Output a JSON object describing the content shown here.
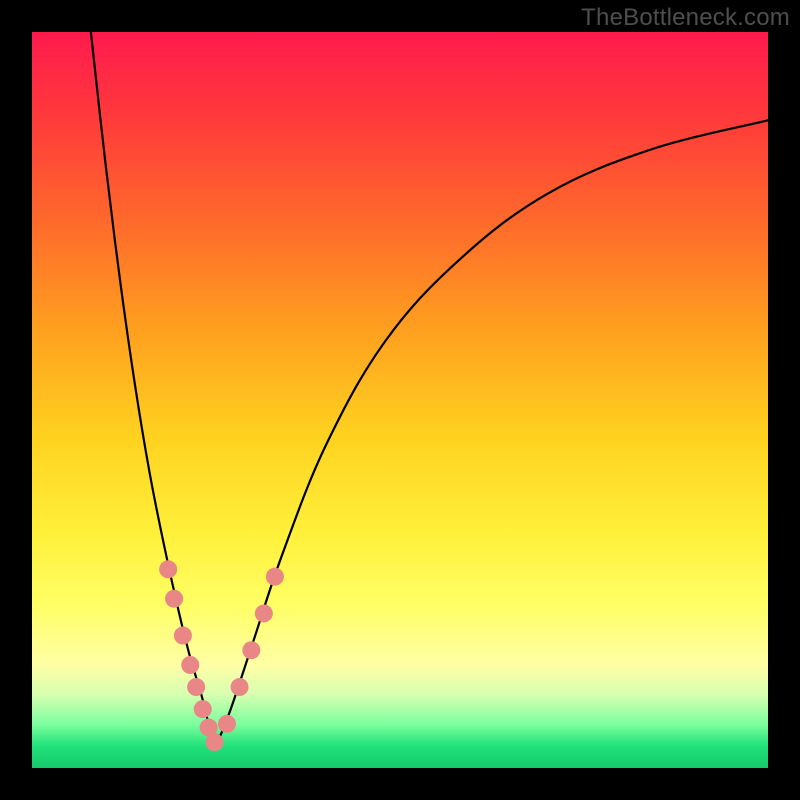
{
  "watermark": "TheBottleneck.com",
  "chart_data": {
    "type": "line",
    "title": "",
    "xlabel": "",
    "ylabel": "",
    "xlim": [
      0,
      100
    ],
    "ylim": [
      0,
      100
    ],
    "grid": false,
    "legend": false,
    "description": "Two valley-shaped curves forming a V; left branch descends steeply from top-left, right branch rises from the valley toward the upper-right. Background is a vertical red→yellow→green heat gradient. Salmon dots cluster near the valley bottom on both branches.",
    "series": [
      {
        "name": "left-branch",
        "x": [
          8,
          10,
          12,
          14,
          16,
          18,
          20,
          21.5,
          23,
          24,
          25
        ],
        "y": [
          100,
          82,
          66,
          52,
          40,
          30,
          21,
          15,
          10,
          6,
          3
        ]
      },
      {
        "name": "right-branch",
        "x": [
          25,
          27,
          30,
          34,
          40,
          48,
          58,
          70,
          84,
          100
        ],
        "y": [
          3,
          8,
          17,
          29,
          44,
          58,
          69,
          78,
          84,
          88
        ]
      }
    ],
    "dots": [
      {
        "branch": "left",
        "x": 18.5,
        "y": 27
      },
      {
        "branch": "left",
        "x": 19.3,
        "y": 23
      },
      {
        "branch": "left",
        "x": 20.5,
        "y": 18
      },
      {
        "branch": "left",
        "x": 21.5,
        "y": 14
      },
      {
        "branch": "left",
        "x": 22.3,
        "y": 11
      },
      {
        "branch": "left",
        "x": 23.2,
        "y": 8
      },
      {
        "branch": "left",
        "x": 24.0,
        "y": 5.5
      },
      {
        "branch": "left",
        "x": 24.8,
        "y": 3.5
      },
      {
        "branch": "right",
        "x": 26.5,
        "y": 6
      },
      {
        "branch": "right",
        "x": 28.2,
        "y": 11
      },
      {
        "branch": "right",
        "x": 29.8,
        "y": 16
      },
      {
        "branch": "right",
        "x": 31.5,
        "y": 21
      },
      {
        "branch": "right",
        "x": 33.0,
        "y": 26
      }
    ]
  }
}
